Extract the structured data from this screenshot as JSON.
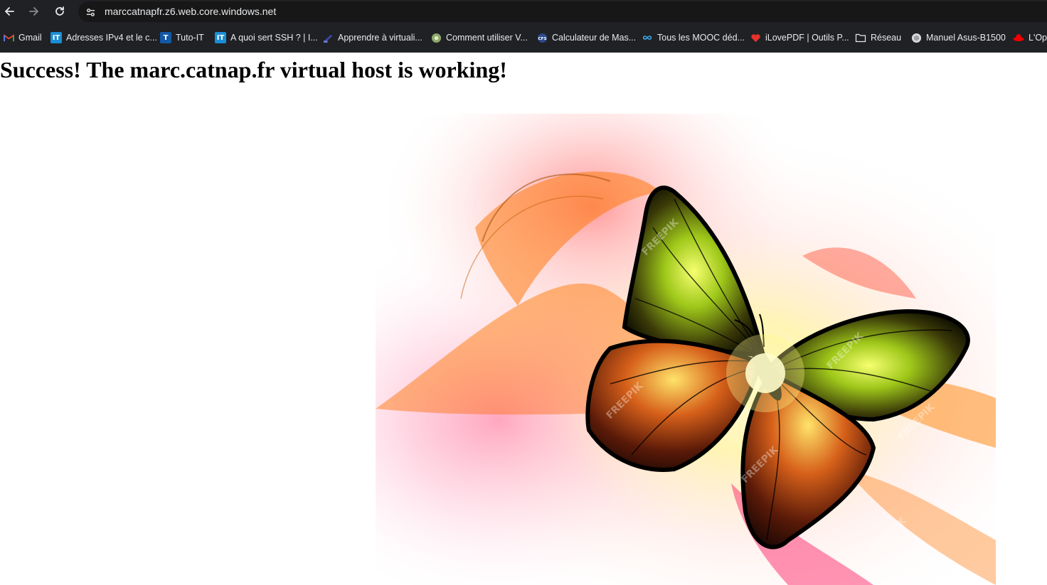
{
  "browser": {
    "url": "marccatnapfr.z6.web.core.windows.net",
    "icons": {
      "back": "arrow-left-icon",
      "forward": "arrow-right-icon",
      "reload": "reload-icon",
      "site_info": "tune-icon"
    }
  },
  "bookmarks": [
    {
      "label": "Gmail",
      "icon": "gmail-icon"
    },
    {
      "label": "Adresses IPv4 et le c...",
      "icon": "it-icon",
      "badge": "IT"
    },
    {
      "label": "Tuto-IT",
      "icon": "tuto-it-icon",
      "badge": "T"
    },
    {
      "label": "A quoi sert SSH ? | I...",
      "icon": "it-icon",
      "badge": "IT"
    },
    {
      "label": "Apprendre à virtuali...",
      "icon": "virtualization-icon"
    },
    {
      "label": "Comment utiliser V...",
      "icon": "globe-icon"
    },
    {
      "label": "Calculateur de Mas...",
      "icon": "calculator-icon"
    },
    {
      "label": "Tous les MOOC déd...",
      "icon": "infinity-icon"
    },
    {
      "label": "iLovePDF | Outils P...",
      "icon": "heart-icon"
    },
    {
      "label": "Réseau",
      "icon": "folder-icon"
    },
    {
      "label": "Manuel Asus-B1500",
      "icon": "globe-icon"
    },
    {
      "label": "L'Op",
      "icon": "redhat-icon"
    }
  ],
  "page": {
    "heading": "Success! The marc.catnap.fr virtual host is working!",
    "image": {
      "subject": "butterfly-illustration",
      "watermark": "FREEPIK"
    }
  }
}
